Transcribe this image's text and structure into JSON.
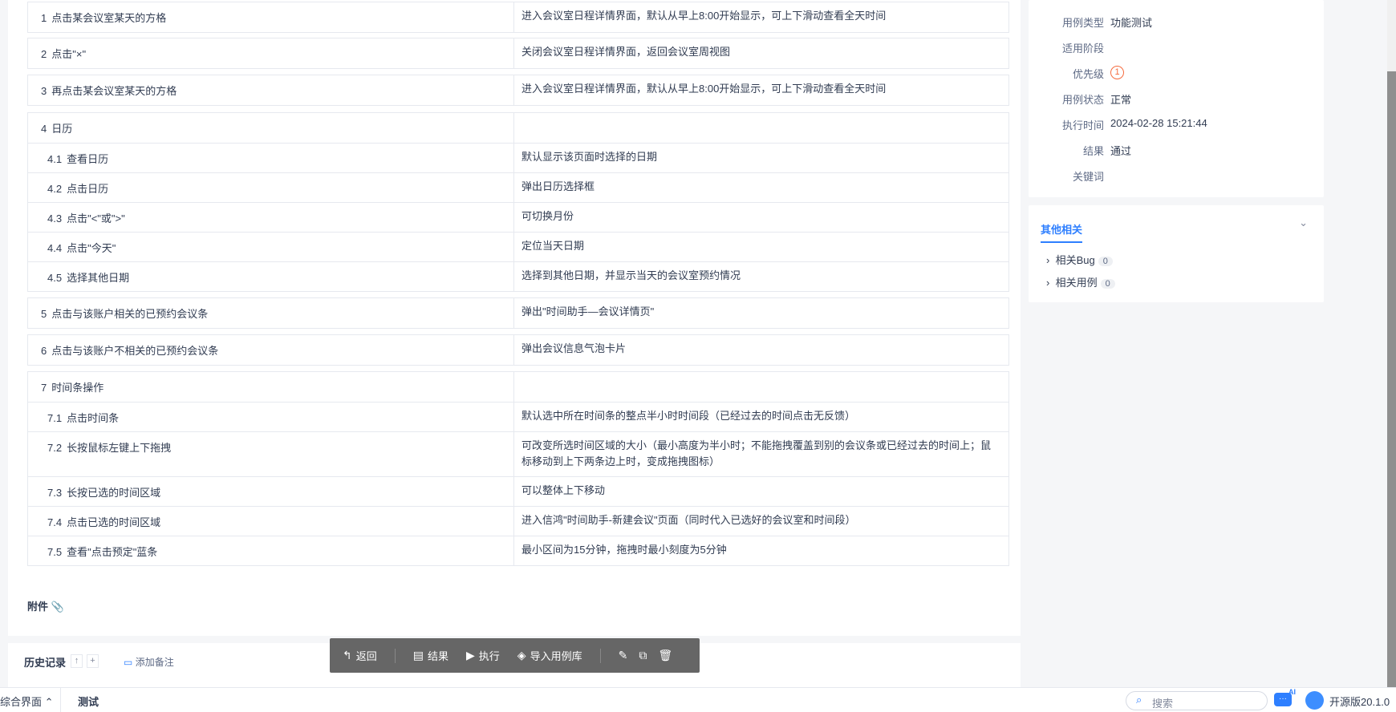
{
  "steps": [
    {
      "num": "1",
      "step": "点击某会议室某天的方格",
      "expect": "进入会议室日程详情界面，默认从早上8:00开始显示，可上下滑动查看全天时间"
    },
    {
      "num": "2",
      "step": "点击\"×\"",
      "expect": "关闭会议室日程详情界面，返回会议室周视图"
    },
    {
      "num": "3",
      "step": "再点击某会议室某天的方格",
      "expect": "进入会议室日程详情界面，默认从早上8:00开始显示，可上下滑动查看全天时间"
    },
    {
      "num": "4",
      "step": "日历",
      "expect": "",
      "subs": [
        {
          "num": "4.1",
          "step": "查看日历",
          "expect": "默认显示该页面时选择的日期"
        },
        {
          "num": "4.2",
          "step": "点击日历",
          "expect": "弹出日历选择框"
        },
        {
          "num": "4.3",
          "step": "点击\"<\"或\">\"",
          "expect": "可切换月份"
        },
        {
          "num": "4.4",
          "step": "点击\"今天\"",
          "expect": "定位当天日期"
        },
        {
          "num": "4.5",
          "step": "选择其他日期",
          "expect": "选择到其他日期，并显示当天的会议室预约情况"
        }
      ]
    },
    {
      "num": "5",
      "step": "点击与该账户相关的已预约会议条",
      "expect": "弹出\"时间助手—会议详情页\""
    },
    {
      "num": "6",
      "step": "点击与该账户不相关的已预约会议条",
      "expect": "弹出会议信息气泡卡片"
    },
    {
      "num": "7",
      "step": "时间条操作",
      "expect": "",
      "subs": [
        {
          "num": "7.1",
          "step": "点击时间条",
          "expect": "默认选中所在时间条的整点半小时时间段（已经过去的时间点击无反馈）"
        },
        {
          "num": "7.2",
          "step": "长按鼠标左键上下拖拽",
          "expect": "可改变所选时间区域的大小（最小高度为半小时；不能拖拽覆盖到别的会议条或已经过去的时间上；鼠标移动到上下两条边上时，变成拖拽图标）"
        },
        {
          "num": "7.3",
          "step": "长按已选的时间区域",
          "expect": "可以整体上下移动"
        },
        {
          "num": "7.4",
          "step": "点击已选的时间区域",
          "expect": "进入信鸿\"时间助手-新建会议\"页面（同时代入已选好的会议室和时间段）"
        },
        {
          "num": "7.5",
          "step": "查看\"点击预定\"蓝条",
          "expect": "最小区间为15分钟，拖拽时最小刻度为5分钟"
        }
      ]
    }
  ],
  "attachment_label": "附件",
  "history": {
    "title": "历史记录",
    "up": "↑",
    "plus": "+",
    "add_note": "添加备注"
  },
  "toolbar": {
    "back": "返回",
    "result": "结果",
    "run": "执行",
    "import": "导入用例库"
  },
  "info": [
    {
      "k": "用例类型",
      "v": "功能测试"
    },
    {
      "k": "适用阶段",
      "v": ""
    },
    {
      "k": "优先级",
      "v": "1"
    },
    {
      "k": "用例状态",
      "v": "正常"
    },
    {
      "k": "执行时间",
      "v": "2024-02-28 15:21:44"
    },
    {
      "k": "结果",
      "v": "通过"
    },
    {
      "k": "关键词",
      "v": ""
    }
  ],
  "related": {
    "title": "其他相关",
    "bug_label": "相关Bug",
    "bug_count": "0",
    "case_label": "相关用例",
    "case_count": "0"
  },
  "bottom": {
    "nav": "综合界面",
    "tab": "测试",
    "search_placeholder": "搜索",
    "ai": "AI",
    "version": "开源版20.1.0"
  },
  "colors": {
    "accent": "#2e7fff",
    "priority": "#f56c3f"
  }
}
